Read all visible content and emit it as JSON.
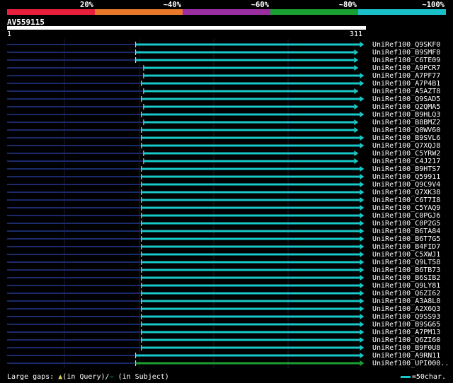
{
  "legend": {
    "labels": [
      "20%",
      "~40%",
      "~60%",
      "~80%",
      "~100%"
    ],
    "colors": [
      "#e8203c",
      "#e8782a",
      "#9b2ea0",
      "#1aa032",
      "#19c0c8"
    ]
  },
  "query": {
    "title": "AV559115",
    "start": "1",
    "end": "311"
  },
  "hits": [
    {
      "label": "UniRef100_Q9SKF0",
      "start": 114,
      "end": 311,
      "color": "#19c8c8"
    },
    {
      "label": "UniRef100_B9SMF8",
      "start": 114,
      "end": 306,
      "color": "#19c8c8"
    },
    {
      "label": "UniRef100_C6TE09",
      "start": 114,
      "end": 306,
      "color": "#19c8c8"
    },
    {
      "label": "UniRef100_A9PCR7",
      "start": 121,
      "end": 306,
      "color": "#19c8c8"
    },
    {
      "label": "UniRef100_A7PF77",
      "start": 121,
      "end": 311,
      "color": "#19c8c8"
    },
    {
      "label": "UniRef100_A7P4B1",
      "start": 119,
      "end": 311,
      "color": "#19c8c8"
    },
    {
      "label": "UniRef100_A5AZT8",
      "start": 121,
      "end": 306,
      "color": "#19c8c8"
    },
    {
      "label": "UniRef100_Q9SAD5",
      "start": 119,
      "end": 311,
      "color": "#19c8c8"
    },
    {
      "label": "UniRef100_Q2QMA5",
      "start": 121,
      "end": 306,
      "color": "#19c8c8"
    },
    {
      "label": "UniRef100_B9HLQ3",
      "start": 119,
      "end": 311,
      "color": "#19c8c8"
    },
    {
      "label": "UniRef100_B8BMZ2",
      "start": 121,
      "end": 306,
      "color": "#19c8c8"
    },
    {
      "label": "UniRef100_Q0WV60",
      "start": 119,
      "end": 306,
      "color": "#19c8c8"
    },
    {
      "label": "UniRef100_B9SVL6",
      "start": 119,
      "end": 311,
      "color": "#19c8c8"
    },
    {
      "label": "UniRef100_Q7XQJ8",
      "start": 119,
      "end": 311,
      "color": "#19c8c8"
    },
    {
      "label": "UniRef100_C5YRW2",
      "start": 121,
      "end": 306,
      "color": "#19c8c8"
    },
    {
      "label": "UniRef100_C4J217",
      "start": 121,
      "end": 306,
      "color": "#19c8c8"
    },
    {
      "label": "UniRef100_B9HTS7",
      "start": 119,
      "end": 311,
      "color": "#19c8c8"
    },
    {
      "label": "UniRef100_Q59911",
      "start": 119,
      "end": 311,
      "color": "#19c8c8"
    },
    {
      "label": "UniRef100_Q9C9V4",
      "start": 119,
      "end": 311,
      "color": "#19c8c8"
    },
    {
      "label": "UniRef100_Q7XK38",
      "start": 119,
      "end": 311,
      "color": "#19c8c8"
    },
    {
      "label": "UniRef100_C6T7I8",
      "start": 119,
      "end": 311,
      "color": "#19c8c8"
    },
    {
      "label": "UniRef100_C5YAQ9",
      "start": 119,
      "end": 311,
      "color": "#19c8c8"
    },
    {
      "label": "UniRef100_C0PGJ6",
      "start": 119,
      "end": 311,
      "color": "#19c8c8"
    },
    {
      "label": "UniRef100_C0P2G5",
      "start": 119,
      "end": 311,
      "color": "#19c8c8"
    },
    {
      "label": "UniRef100_B6TA84",
      "start": 119,
      "end": 311,
      "color": "#19c8c8"
    },
    {
      "label": "UniRef100_B6T7G5",
      "start": 119,
      "end": 311,
      "color": "#19c8c8"
    },
    {
      "label": "UniRef100_B4FID7",
      "start": 119,
      "end": 311,
      "color": "#19c8c8"
    },
    {
      "label": "UniRef100_C5XWJ1",
      "start": 119,
      "end": 311,
      "color": "#19c8c8"
    },
    {
      "label": "UniRef100_Q9LT58",
      "start": 119,
      "end": 311,
      "color": "#19c8c8"
    },
    {
      "label": "UniRef100_B6TB73",
      "start": 119,
      "end": 311,
      "color": "#19c8c8"
    },
    {
      "label": "UniRef100_B6SIB2",
      "start": 119,
      "end": 311,
      "color": "#19c8c8"
    },
    {
      "label": "UniRef100_Q9LY81",
      "start": 119,
      "end": 311,
      "color": "#19c8c8"
    },
    {
      "label": "UniRef100_Q6ZI62",
      "start": 119,
      "end": 311,
      "color": "#19c8c8"
    },
    {
      "label": "UniRef100_A3A8L8",
      "start": 119,
      "end": 311,
      "color": "#19c8c8"
    },
    {
      "label": "UniRef100_A2X6Q3",
      "start": 119,
      "end": 311,
      "color": "#19c8c8"
    },
    {
      "label": "UniRef100_Q9SS93",
      "start": 119,
      "end": 311,
      "color": "#19c8c8"
    },
    {
      "label": "UniRef100_B9SG65",
      "start": 119,
      "end": 311,
      "color": "#19c8c8"
    },
    {
      "label": "UniRef100_A7PM13",
      "start": 119,
      "end": 311,
      "color": "#19c8c8"
    },
    {
      "label": "UniRef100_Q6ZI60",
      "start": 119,
      "end": 311,
      "color": "#19c8c8"
    },
    {
      "label": "UniRef100_B9F0U8",
      "start": 119,
      "end": 311,
      "color": "#19c8c8"
    },
    {
      "label": "UniRef100_A9RN11",
      "start": 114,
      "end": 311,
      "color": "#19c8c8"
    },
    {
      "label": "UniRef100_UPI000..",
      "start": 114,
      "end": 311,
      "color": "#1aa032"
    }
  ],
  "footer": {
    "gaps_text": "Large gaps:",
    "query_gap_symbol": "▲",
    "query_gap_text": "(in Query)/",
    "subject_gap_symbol": "—",
    "subject_gap_text": " (in Subject)",
    "scale_text": "=50char."
  }
}
